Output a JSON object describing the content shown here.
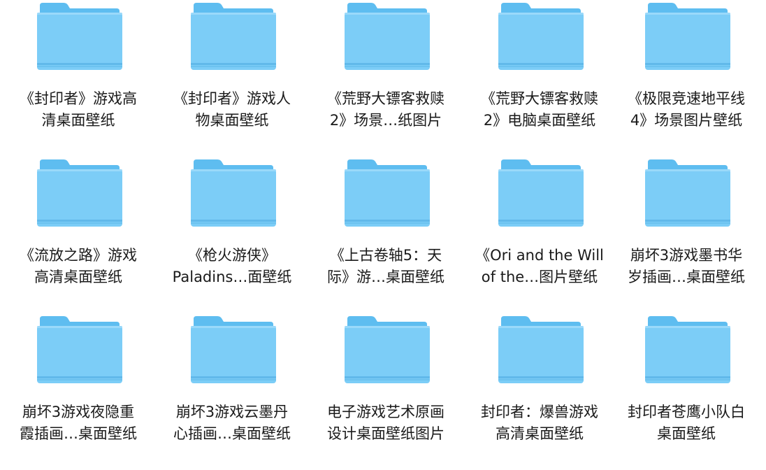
{
  "items": [
    {
      "line1": "《封印者》游戏高",
      "line2": "清桌面壁纸",
      "icon": "folder-icon"
    },
    {
      "line1": "《封印者》游戏人",
      "line2": "物桌面壁纸",
      "icon": "folder-icon"
    },
    {
      "line1": "《荒野大镖客救赎",
      "line2": "2》场景…纸图片",
      "icon": "folder-icon"
    },
    {
      "line1": "《荒野大镖客救赎",
      "line2": "2》电脑桌面壁纸",
      "icon": "folder-icon"
    },
    {
      "line1": "《极限竞速地平线",
      "line2": "4》场景图片壁纸",
      "icon": "folder-icon"
    },
    {
      "line1": "《流放之路》游戏",
      "line2": "高清桌面壁纸",
      "icon": "folder-icon"
    },
    {
      "line1": "《枪火游侠》",
      "line2": "Paladins…面壁纸",
      "icon": "folder-icon"
    },
    {
      "line1": "《上古卷轴5：天",
      "line2": "际》游…桌面壁纸",
      "icon": "folder-icon"
    },
    {
      "line1": "《Ori and the Will",
      "line2": "of the…图片壁纸",
      "icon": "folder-icon"
    },
    {
      "line1": "崩坏3游戏墨书华",
      "line2": "岁插画…桌面壁纸",
      "icon": "folder-icon"
    },
    {
      "line1": "崩坏3游戏夜隐重",
      "line2": "霞插画…桌面壁纸",
      "icon": "folder-icon"
    },
    {
      "line1": "崩坏3游戏云墨丹",
      "line2": "心插画…桌面壁纸",
      "icon": "folder-icon"
    },
    {
      "line1": "电子游戏艺术原画",
      "line2": "设计桌面壁纸图片",
      "icon": "folder-icon"
    },
    {
      "line1": "封印者：爆兽游戏",
      "line2": "高清桌面壁纸",
      "icon": "folder-icon"
    },
    {
      "line1": "封印者苍鹰小队白",
      "line2": "桌面壁纸",
      "icon": "folder-icon"
    }
  ],
  "colors": {
    "folder_tab": "#5ebdf0",
    "folder_body": "#7ccdf7",
    "folder_edge": "#4fb2ea",
    "label_text": "#1a1a1a"
  }
}
